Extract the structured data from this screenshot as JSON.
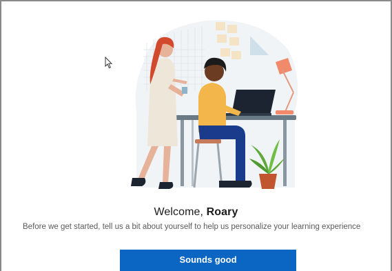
{
  "welcome": {
    "greeting": "Welcome,",
    "name": "Roary"
  },
  "subtitle": "Before we get started, tell us a bit about yourself to help us personalize your learning experience",
  "cta": {
    "label": "Sounds good"
  },
  "illustration": {
    "icon": "onboarding-illustration",
    "colors": {
      "blob": "#edf1f4",
      "desk": "#6b7b86",
      "shirt": "#f2b64a",
      "pants": "#1a3b8c",
      "hair_woman": "#d24a2e",
      "dress": "#efe6da",
      "lamp": "#f08a6b",
      "laptop": "#1b2430",
      "plant": "#5fa83b",
      "pot": "#c0552f"
    }
  },
  "colors": {
    "primary_button": "#0a66c2",
    "text": "#1c1c1c",
    "muted_text": "#5a5a5a"
  }
}
